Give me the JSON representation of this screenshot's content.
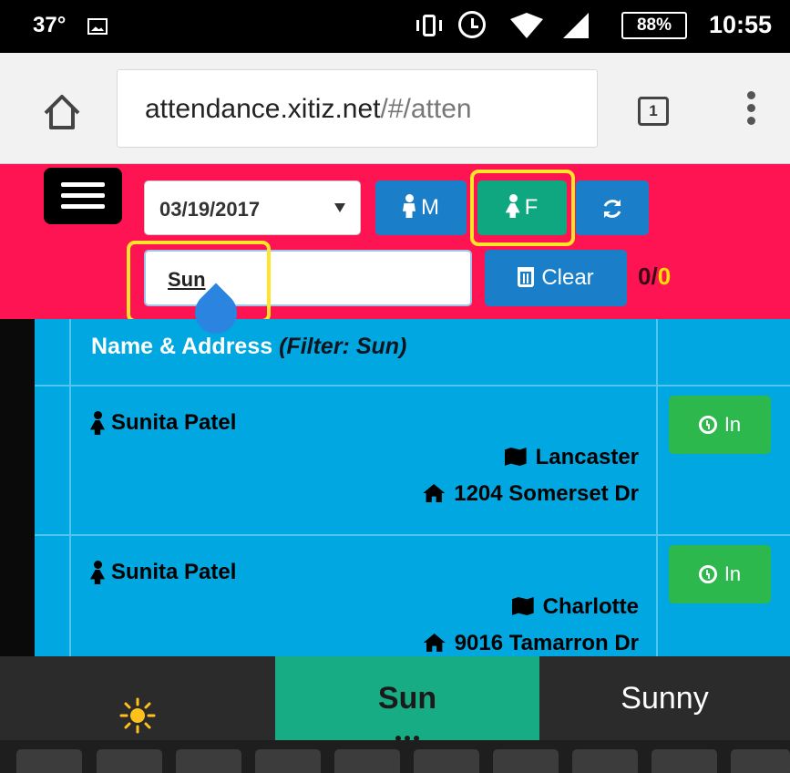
{
  "status_bar": {
    "temperature": "37°",
    "battery": "88%",
    "time": "10:55",
    "icons": [
      "image-icon",
      "vibrate-icon",
      "alarm-icon",
      "wifi-icon",
      "signal-icon",
      "battery-icon"
    ]
  },
  "browser": {
    "url_host": "attendance.xitiz.net",
    "url_path": "/#/atten",
    "tab_count": "1"
  },
  "toolbar": {
    "date_value": "03/19/2017",
    "male_label": "M",
    "female_label": "F",
    "search_value": "Sun",
    "clear_label": "Clear",
    "count_left": "0/",
    "count_right": "0",
    "colors": {
      "toolbar_bg": "#ff1453",
      "blue_button": "#1a7fc8",
      "green_button": "#0fa77f",
      "highlight": "#ffe42a"
    }
  },
  "table": {
    "header": {
      "label": "Name & Address",
      "filter": "(Filter: Sun)"
    },
    "rows": [
      {
        "name": "Sunita Patel",
        "city": "Lancaster",
        "address": "1204 Somerset Dr",
        "action_label": "In"
      },
      {
        "name": "Sunita Patel",
        "city": "Charlotte",
        "address": "9016 Tamarron Dr",
        "action_label": "In"
      }
    ]
  },
  "keyboard": {
    "suggestions": [
      "sun-emoji",
      "Sun",
      "Sunny"
    ]
  }
}
